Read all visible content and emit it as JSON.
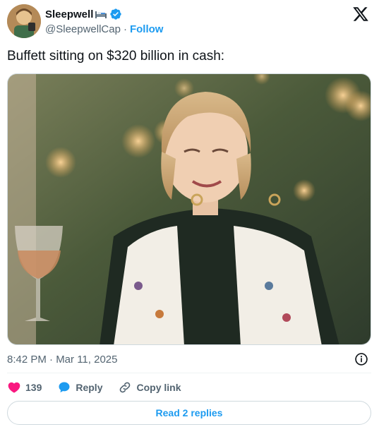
{
  "author": {
    "display_name": "Sleepwell",
    "handle": "@SleepwellCap",
    "follow_label": "Follow",
    "separator": "·",
    "verified": true
  },
  "tweet": {
    "text": "Buffett sitting on $320 billion in cash:"
  },
  "meta": {
    "timestamp": "8:42 PM · Mar 11, 2025"
  },
  "actions": {
    "like_count": "139",
    "reply_label": "Reply",
    "copy_link_label": "Copy link"
  },
  "read_replies_label": "Read 2 replies",
  "icons": {
    "brand": "x-logo-icon",
    "verified": "verified-badge-icon",
    "info": "info-icon",
    "like": "heart-icon",
    "reply": "reply-bubble-icon",
    "copy_link": "link-icon"
  },
  "colors": {
    "accent": "#1d9bf0",
    "like": "#f91880",
    "text": "#0f1419",
    "secondary": "#536471",
    "border": "#cfd9de"
  }
}
